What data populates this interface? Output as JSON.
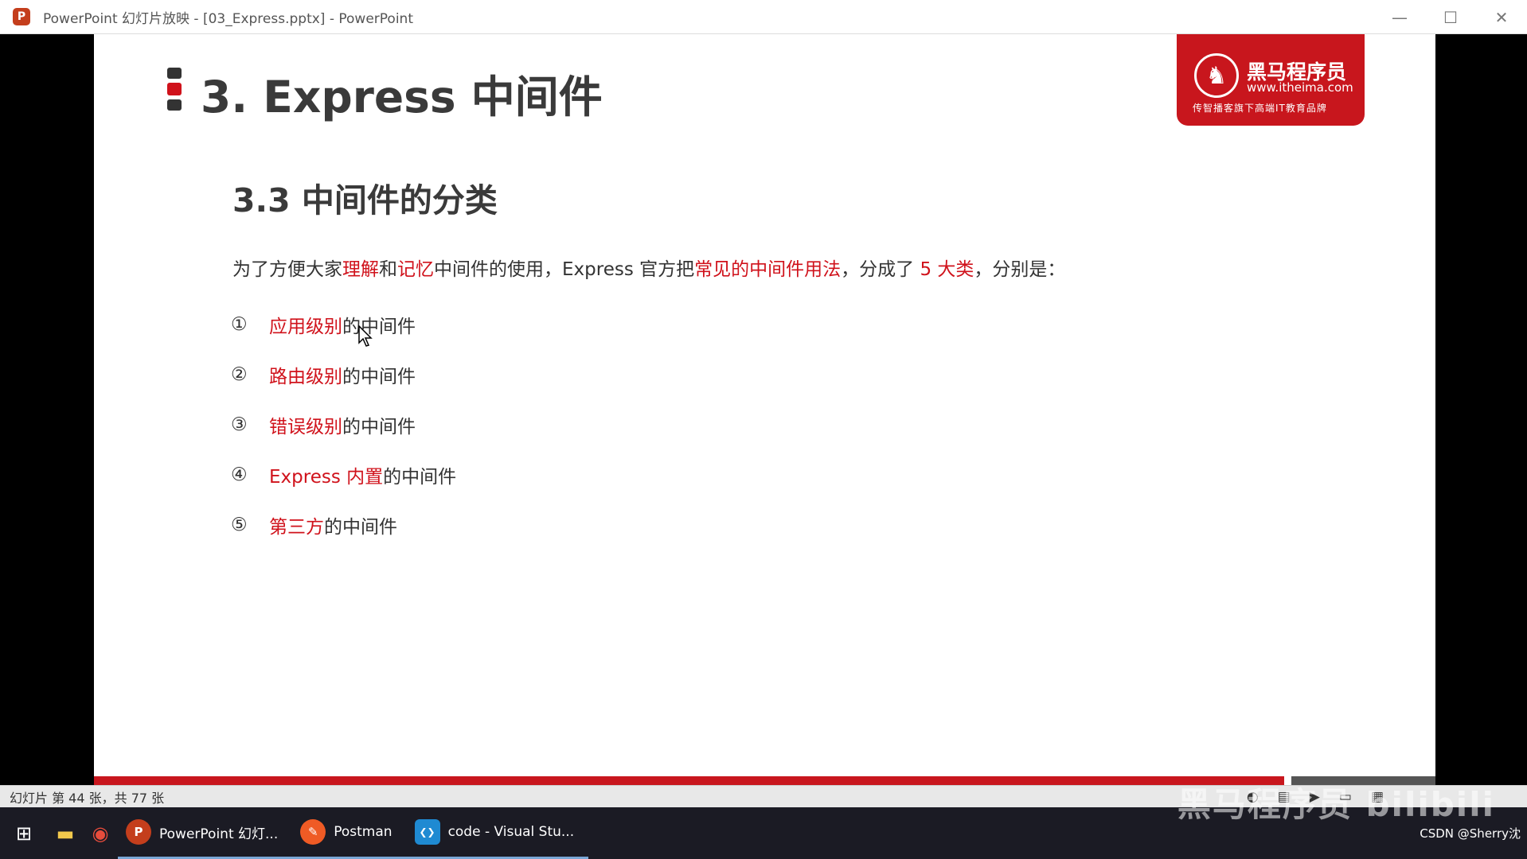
{
  "window": {
    "title": "PowerPoint 幻灯片放映 - [03_Express.pptx] - PowerPoint",
    "app_icon_letter": "P",
    "controls": {
      "minimize": "—",
      "maximize": "☐",
      "close": "✕"
    }
  },
  "slide": {
    "title": "3. Express 中间件",
    "logo": {
      "name": "黑马程序员",
      "url": "www.itheima.com",
      "slogan": "传智播客旗下高端IT教育品牌"
    },
    "subtitle": "3.3 中间件的分类",
    "intro": {
      "p1": "为了方便大家",
      "r1": "理解",
      "p2": "和",
      "r2": "记忆",
      "p3": "中间件的使用，Express 官方把",
      "r3": "常见的中间件用法",
      "p4": "，分成了 ",
      "r4": "5 大类",
      "p5": "，分别是："
    },
    "items": [
      {
        "num": "①",
        "red": "应用级别",
        "rest": "的中间件"
      },
      {
        "num": "②",
        "red": "路由级别",
        "rest": "的中间件"
      },
      {
        "num": "③",
        "red": "错误级别",
        "rest": "的中间件"
      },
      {
        "num": "④",
        "red": "Express 内置",
        "rest": "的中间件"
      },
      {
        "num": "⑤",
        "red": "第三方",
        "rest": "的中间件"
      }
    ]
  },
  "statusbar": {
    "text": "幻灯片 第 44 张，共 77 张"
  },
  "taskbar": {
    "apps": [
      {
        "label": "PowerPoint 幻灯...",
        "icon": "P",
        "color": "#c43e1c"
      },
      {
        "label": "Postman",
        "icon": "✎",
        "color": "#ef5b25"
      },
      {
        "label": "code - Visual Stu...",
        "icon": "❮❯",
        "color": "#1f8ad2"
      }
    ],
    "tray_text": "CSDN @Sherry沈",
    "watermark": "黑马程序员 bilibili"
  },
  "colors": {
    "accent_red": "#d0121b",
    "brand_red": "#c8161d"
  }
}
